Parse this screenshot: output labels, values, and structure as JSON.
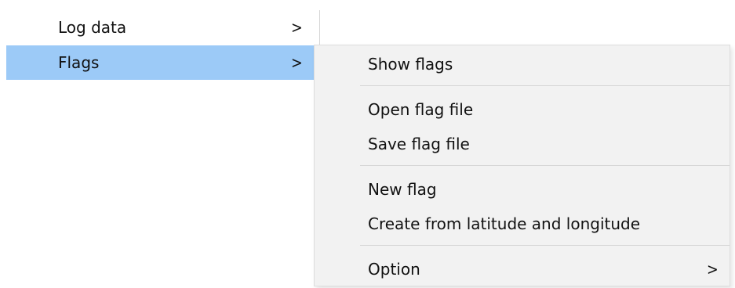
{
  "parent_menu": {
    "items": [
      {
        "label": "Log data",
        "arrow": ">"
      },
      {
        "label": "Flags",
        "arrow": ">"
      }
    ]
  },
  "submenu": {
    "show_flags": "Show flags",
    "open_flag_file": "Open flag file",
    "save_flag_file": "Save flag file",
    "new_flag": "New flag",
    "create_from_latitude_longitude": "Create from latitude and longitude",
    "option": {
      "label": "Option",
      "arrow": ">"
    }
  },
  "colors": {
    "selected_item": "#9ccaf7",
    "submenu_background": "#f2f2f2",
    "separator": "#d6d6d6"
  },
  "icons": {
    "submenu_arrow": "chevron-right-icon"
  }
}
